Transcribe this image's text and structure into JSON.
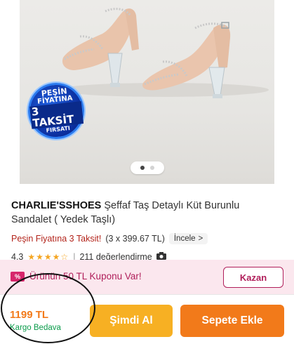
{
  "product": {
    "brand": "CHARLIE'SSHOES",
    "name": "Şeffaf Taş Detaylı Küt Burunlu Sandalet ( Yedek Taşlı)"
  },
  "hero": {
    "badge_line1": "PEŞİN",
    "badge_line2": "FİYATINA",
    "badge_line3": "3 TAKSİT",
    "badge_line4": "FIRSATI",
    "page_count": 2,
    "active_page": 1
  },
  "installment": {
    "text": "Peşin Fiyatına 3 Taksit!",
    "detail": "(3 x 399.67 TL)",
    "inspect_label": "İncele",
    "inspect_chevron": ">"
  },
  "rating": {
    "score": "4.3",
    "stars": "★★★★☆",
    "separator": "|",
    "reviews": "211 değerlendirme",
    "icon": "camera-icon"
  },
  "coupon": {
    "icon_text": "%",
    "text": "Ürünün 50 TL Kuponu Var!",
    "button": "Kazan"
  },
  "purchase": {
    "price": "1199 TL",
    "shipping": "Kargo Bedava",
    "buy_now": "Şimdi Al",
    "add_to_cart": "Sepete Ekle"
  },
  "colors": {
    "primary_orange": "#f27a1a",
    "buy_now_yellow": "#f7b023",
    "coupon_magenta": "#b01e5a",
    "installment_red": "#b3241b",
    "shipping_green": "#0a9b4a",
    "star": "#f5a623"
  }
}
